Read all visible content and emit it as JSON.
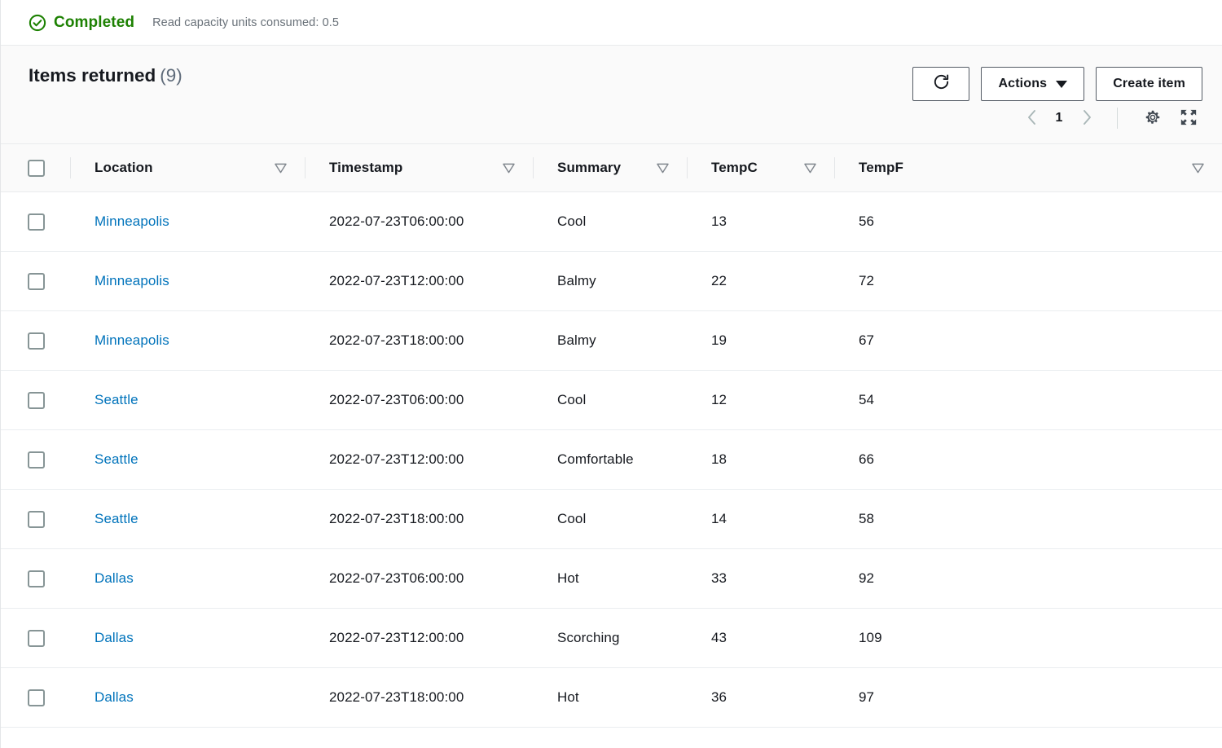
{
  "status": {
    "icon": "check-circle-icon",
    "label": "Completed",
    "meta": "Read capacity units consumed: 0.5",
    "color": "#1d8102"
  },
  "panel": {
    "title": "Items returned",
    "count": "(9)",
    "refresh_icon": "refresh-icon",
    "actions_label": "Actions",
    "create_item_label": "Create item"
  },
  "pagination": {
    "prev_icon": "chevron-left-icon",
    "page": "1",
    "next_icon": "chevron-right-icon",
    "settings_icon": "gear-icon",
    "fullscreen_icon": "expand-icon"
  },
  "table": {
    "columns": [
      {
        "label": "Location",
        "sortable": true
      },
      {
        "label": "Timestamp",
        "sortable": true
      },
      {
        "label": "Summary",
        "sortable": true
      },
      {
        "label": "TempC",
        "sortable": true
      },
      {
        "label": "TempF",
        "sortable": true
      }
    ],
    "rows": [
      {
        "location": "Minneapolis",
        "timestamp": "2022-07-23T06:00:00",
        "summary": "Cool",
        "tempc": "13",
        "tempf": "56"
      },
      {
        "location": "Minneapolis",
        "timestamp": "2022-07-23T12:00:00",
        "summary": "Balmy",
        "tempc": "22",
        "tempf": "72"
      },
      {
        "location": "Minneapolis",
        "timestamp": "2022-07-23T18:00:00",
        "summary": "Balmy",
        "tempc": "19",
        "tempf": "67"
      },
      {
        "location": "Seattle",
        "timestamp": "2022-07-23T06:00:00",
        "summary": "Cool",
        "tempc": "12",
        "tempf": "54"
      },
      {
        "location": "Seattle",
        "timestamp": "2022-07-23T12:00:00",
        "summary": "Comfortable",
        "tempc": "18",
        "tempf": "66"
      },
      {
        "location": "Seattle",
        "timestamp": "2022-07-23T18:00:00",
        "summary": "Cool",
        "tempc": "14",
        "tempf": "58"
      },
      {
        "location": "Dallas",
        "timestamp": "2022-07-23T06:00:00",
        "summary": "Hot",
        "tempc": "33",
        "tempf": "92"
      },
      {
        "location": "Dallas",
        "timestamp": "2022-07-23T12:00:00",
        "summary": "Scorching",
        "tempc": "43",
        "tempf": "109"
      },
      {
        "location": "Dallas",
        "timestamp": "2022-07-23T18:00:00",
        "summary": "Hot",
        "tempc": "36",
        "tempf": "97"
      }
    ]
  },
  "colors": {
    "link": "#0073bb",
    "success": "#1d8102",
    "header_bg": "#fafafa",
    "border": "#e9ebed"
  }
}
